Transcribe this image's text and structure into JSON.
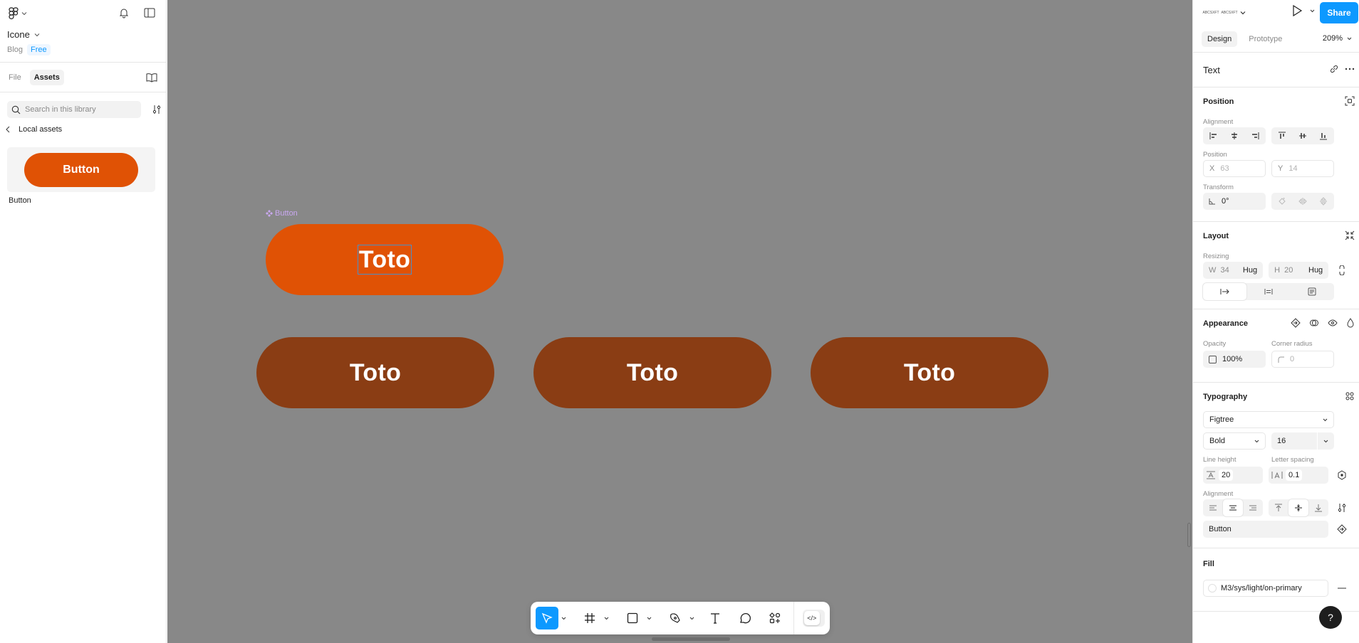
{
  "left_panel": {
    "file_name": "Icone",
    "project": "Blog",
    "plan_badge": "Free",
    "tabs": [
      {
        "label": "File",
        "active": false
      },
      {
        "label": "Assets",
        "active": true
      }
    ],
    "search_placeholder": "Search in this library",
    "back_label": "Local assets",
    "asset": {
      "preview_text": "Button",
      "name": "Button"
    }
  },
  "canvas": {
    "component_label": "Button",
    "selected_button_text": "Toto",
    "instances": [
      {
        "text": "Toto"
      },
      {
        "text": "Toto"
      },
      {
        "text": "Toto"
      }
    ],
    "colors": {
      "background": "#888888",
      "primary": "#e05205",
      "instance": "#8a3d14",
      "selection": "#4a90c8",
      "component_label": "#c9a8f0"
    }
  },
  "toolbar": {
    "tools": [
      {
        "name": "move",
        "icon": "cursor-icon",
        "active": true
      },
      {
        "name": "frame",
        "icon": "frame-icon",
        "active": false
      },
      {
        "name": "shape",
        "icon": "rectangle-icon",
        "active": false
      },
      {
        "name": "pen",
        "icon": "pen-icon",
        "active": false
      },
      {
        "name": "text",
        "icon": "text-icon",
        "active": false
      },
      {
        "name": "comment",
        "icon": "comment-icon",
        "active": false
      },
      {
        "name": "actions",
        "icon": "actions-icon",
        "active": false
      }
    ],
    "dev_mode_label": "</>"
  },
  "right_panel": {
    "avatars": [
      "ABCSXFT",
      "ABCSXFT"
    ],
    "share_label": "Share",
    "tabs": [
      {
        "label": "Design",
        "active": true
      },
      {
        "label": "Prototype",
        "active": false
      }
    ],
    "zoom": "209%",
    "layer_type": "Text",
    "position": {
      "title": "Position",
      "alignment_label": "Alignment",
      "position_label": "Position",
      "x_key": "X",
      "x": "63",
      "y_key": "Y",
      "y": "14",
      "transform_label": "Transform",
      "rotation": "0°"
    },
    "layout": {
      "title": "Layout",
      "resizing_label": "Resizing",
      "w_key": "W",
      "w": "34",
      "w_mode": "Hug",
      "h_key": "H",
      "h": "20",
      "h_mode": "Hug"
    },
    "appearance": {
      "title": "Appearance",
      "opacity_label": "Opacity",
      "opacity": "100%",
      "corner_label": "Corner radius",
      "corner": "0"
    },
    "typography": {
      "title": "Typography",
      "font_family": "Figtree",
      "font_weight": "Bold",
      "font_size": "16",
      "line_height_label": "Line height",
      "line_height": "20",
      "letter_spacing_label": "Letter spacing",
      "letter_spacing": "0.1",
      "alignment_label": "Alignment",
      "text_style": "Button"
    },
    "fill": {
      "title": "Fill",
      "style_name": "M3/sys/light/on-primary"
    },
    "accent": "#0d99ff"
  },
  "help_label": "?"
}
